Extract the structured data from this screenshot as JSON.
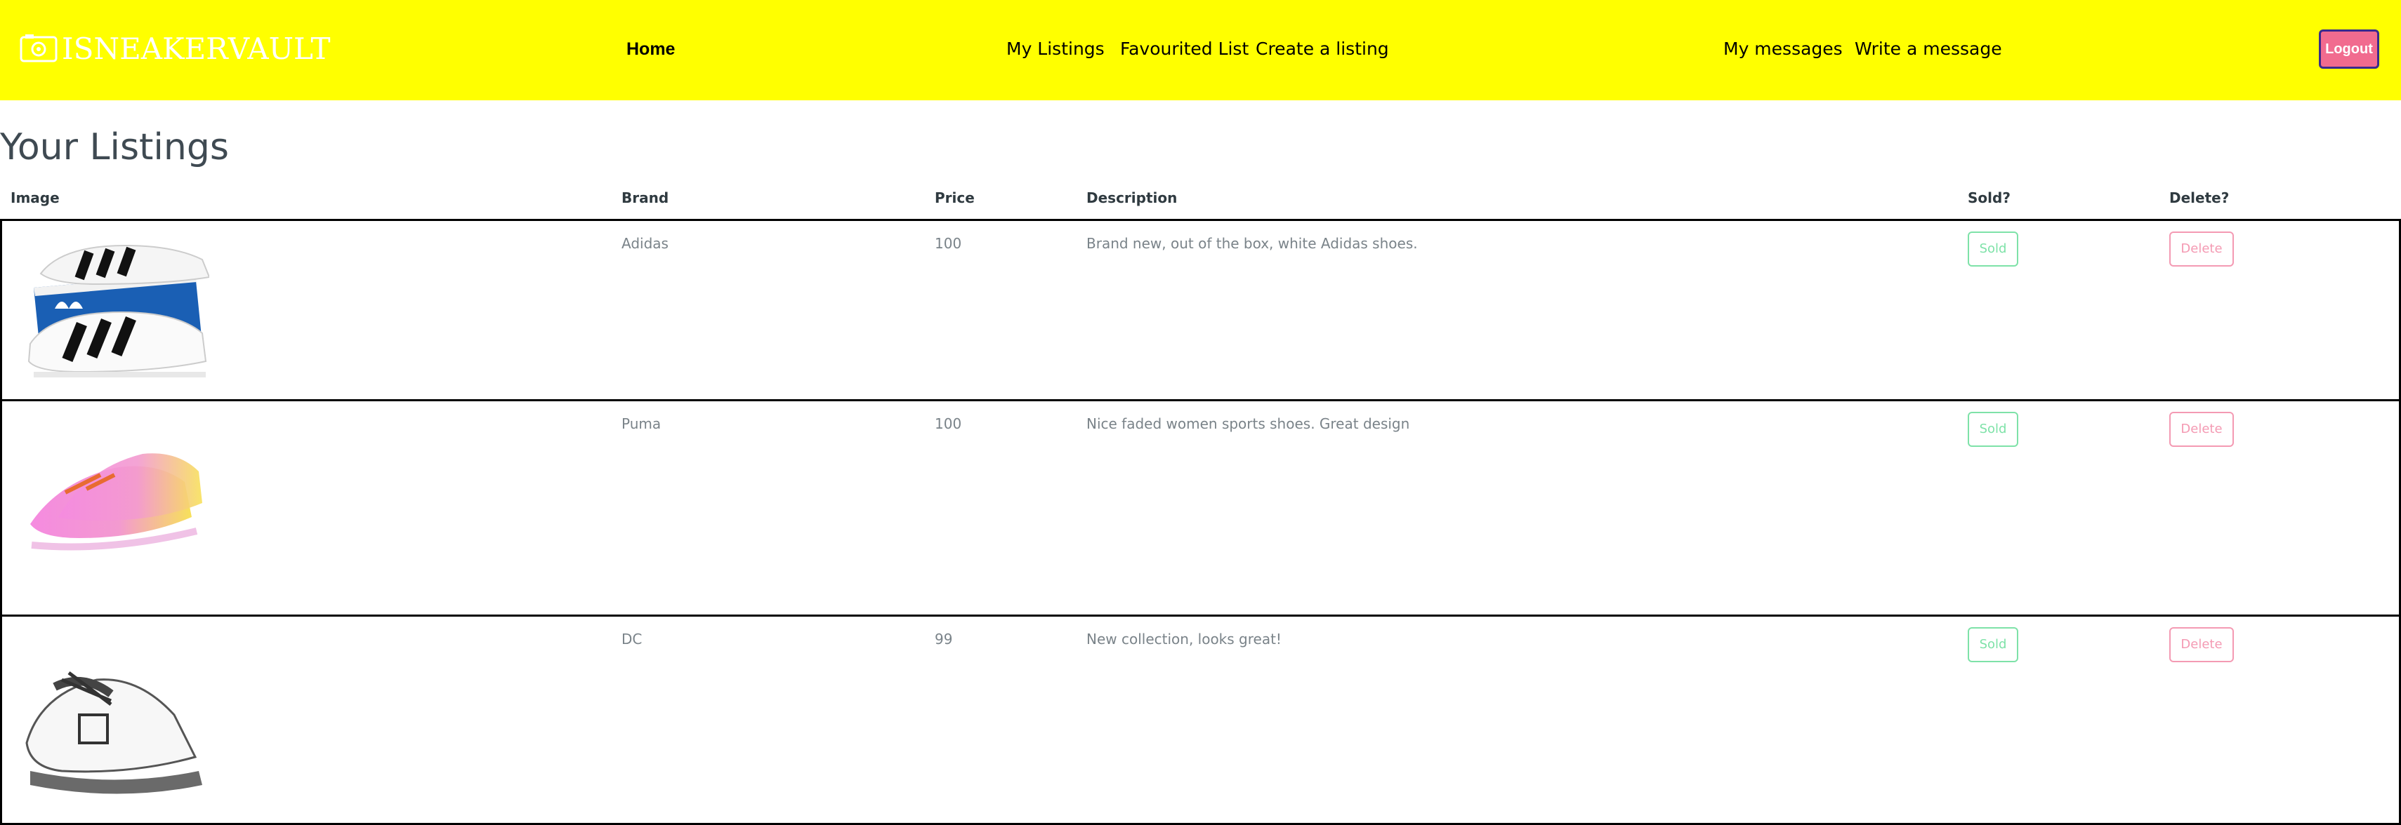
{
  "nav": {
    "brand_part_a": "ISNEAKER",
    "brand_part_b": "VAULT",
    "links": {
      "home": "Home",
      "my_listings": "My Listings",
      "favourited": "Favourited List",
      "create": "Create a listing",
      "messages": "My messages",
      "write": "Write a message"
    },
    "logout": "Logout",
    "colors": {
      "bar": "#ffff00",
      "logout_bg": "#f16b8f",
      "logout_border": "#3a2b8c"
    }
  },
  "page": {
    "title": "Your Listings"
  },
  "table": {
    "headers": {
      "image": "Image",
      "brand": "Brand",
      "price": "Price",
      "description": "Description",
      "sold": "Sold?",
      "delete": "Delete?"
    },
    "rows": [
      {
        "image_icon": "adidas-sneaker-image",
        "brand": "Adidas",
        "price": "100",
        "description": "Brand new, out of the box, white Adidas shoes.",
        "sold_label": "Sold",
        "delete_label": "Delete"
      },
      {
        "image_icon": "puma-sneaker-image",
        "brand": "Puma",
        "price": "100",
        "description": "Nice faded women sports shoes. Great design",
        "sold_label": "Sold",
        "delete_label": "Delete"
      },
      {
        "image_icon": "dc-sneaker-image",
        "brand": "DC",
        "price": "99",
        "description": "New collection, looks great!",
        "sold_label": "Sold",
        "delete_label": "Delete"
      }
    ],
    "colors": {
      "sold": "#7ee2a8",
      "delete": "#f49ab3"
    }
  }
}
